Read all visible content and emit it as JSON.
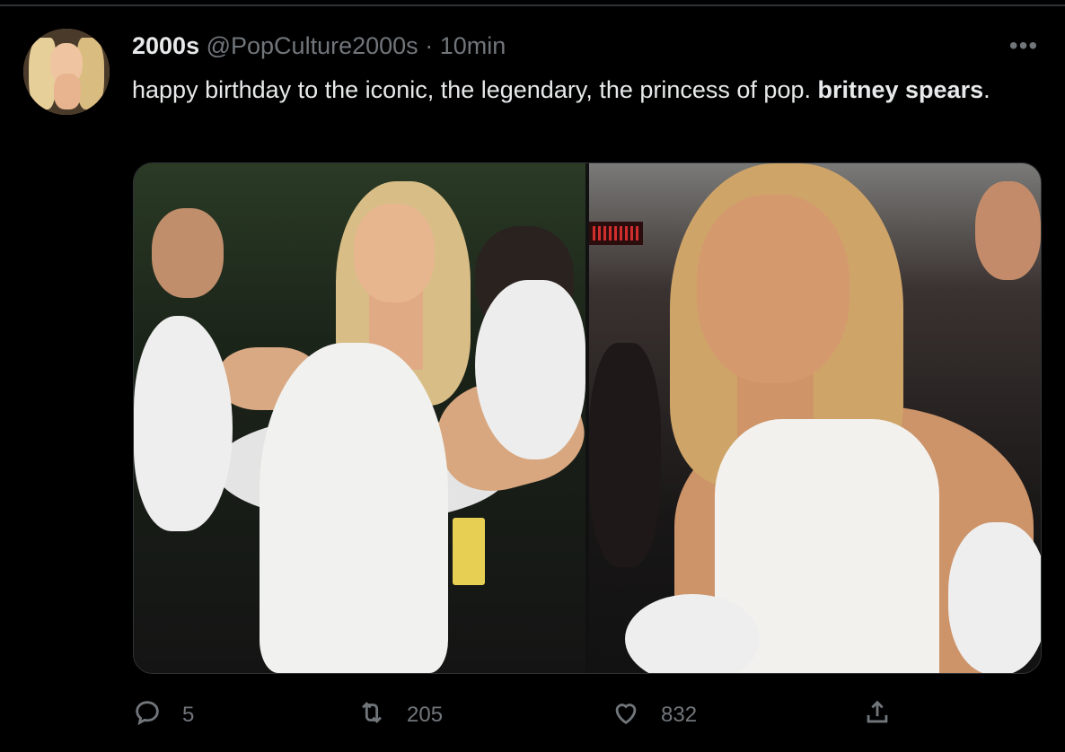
{
  "tweet": {
    "author": {
      "display_name": "2000s",
      "handle": "@PopCulture2000s",
      "separator": "·",
      "time": "10min"
    },
    "text_plain": "happy birthday to the iconic, the legendary, the princess of pop. ",
    "text_bold_1": "britney",
    "text_space": " ",
    "text_bold_2": "spears",
    "text_end": ".",
    "more_label": "•••",
    "media": [
      {
        "icon": "photo-arrival-white-dress"
      },
      {
        "icon": "photo-portrait-white-dress"
      }
    ],
    "actions": {
      "reply": {
        "icon": "reply-icon",
        "count": "5"
      },
      "retweet": {
        "icon": "retweet-icon",
        "count": "205"
      },
      "like": {
        "icon": "heart-icon",
        "count": "832"
      },
      "share": {
        "icon": "share-icon"
      }
    }
  },
  "colors": {
    "background": "#000000",
    "text": "#e7e9ea",
    "muted": "#71767b",
    "border": "#2f3336"
  }
}
